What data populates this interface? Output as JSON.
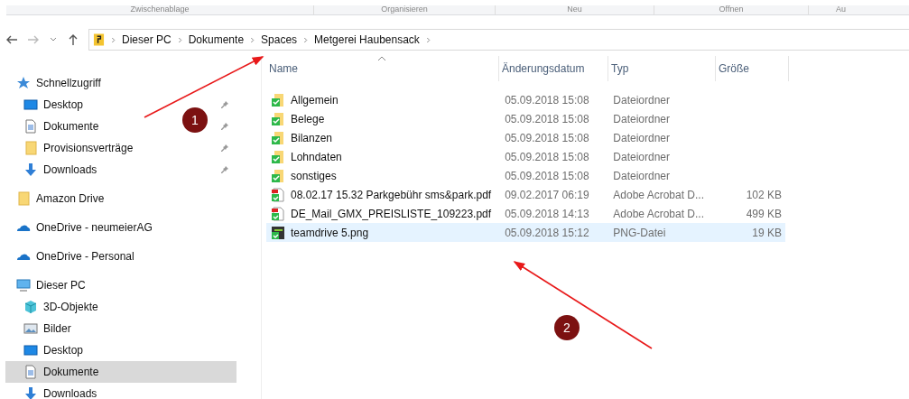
{
  "ribbon_groups": [
    "Zwischenablage",
    "Organisieren",
    "Neu",
    "Öffnen",
    "Au"
  ],
  "address_bar": {
    "path": [
      "Dieser PC",
      "Dokumente",
      "Spaces",
      "Metgerei Haubensack"
    ]
  },
  "sidebar": {
    "items": [
      {
        "label": "Schnellzugriff",
        "kind": "star",
        "selected": false,
        "children": [
          {
            "label": "Desktop",
            "kind": "desktop",
            "pinned": true,
            "selected": false
          },
          {
            "label": "Dokumente",
            "kind": "document",
            "pinned": true,
            "selected": false
          },
          {
            "label": "Provisionsverträge",
            "kind": "folder",
            "pinned": true,
            "selected": false
          },
          {
            "label": "Downloads",
            "kind": "download",
            "pinned": true,
            "selected": false
          }
        ]
      },
      {
        "label": "Amazon Drive",
        "kind": "folder",
        "selected": false
      },
      {
        "label": "OneDrive - neumeierAG",
        "kind": "cloud",
        "selected": false
      },
      {
        "label": "OneDrive - Personal",
        "kind": "cloud",
        "selected": false
      },
      {
        "label": "Dieser PC",
        "kind": "pc",
        "selected": false,
        "children": [
          {
            "label": "3D-Objekte",
            "kind": "cube",
            "pinned": false,
            "selected": false
          },
          {
            "label": "Bilder",
            "kind": "picture",
            "pinned": false,
            "selected": false
          },
          {
            "label": "Desktop",
            "kind": "desktop",
            "pinned": false,
            "selected": false
          },
          {
            "label": "Dokumente",
            "kind": "document",
            "pinned": false,
            "selected": true
          },
          {
            "label": "Downloads",
            "kind": "download",
            "pinned": false,
            "selected": false
          }
        ]
      }
    ]
  },
  "file_list": {
    "columns": [
      "Name",
      "Änderungsdatum",
      "Typ",
      "Größe"
    ],
    "rows": [
      {
        "name": "Allgemein",
        "date": "05.09.2018 15:08",
        "type": "Dateiordner",
        "kind": "folder",
        "selected": false
      },
      {
        "name": "Belege",
        "date": "05.09.2018 15:08",
        "type": "Dateiordner",
        "kind": "folder",
        "selected": false
      },
      {
        "name": "Bilanzen",
        "date": "05.09.2018 15:08",
        "type": "Dateiordner",
        "kind": "folder",
        "selected": false
      },
      {
        "name": "Lohndaten",
        "date": "05.09.2018 15:08",
        "type": "Dateiordner",
        "kind": "folder",
        "selected": false
      },
      {
        "name": "sonstiges",
        "date": "05.09.2018 15:08",
        "type": "Dateiordner",
        "kind": "folder",
        "selected": false
      },
      {
        "name": "08.02.17 15.32 Parkgebühr sms&park.pdf",
        "date": "09.02.2017 06:19",
        "type": "Adobe Acrobat D...",
        "size": "102 KB",
        "kind": "pdf",
        "selected": false
      },
      {
        "name": "DE_Mail_GMX_PREISLISTE_109223.pdf",
        "date": "05.09.2018 14:13",
        "type": "Adobe Acrobat D...",
        "size": "499 KB",
        "kind": "pdf",
        "selected": false
      },
      {
        "name": "teamdrive 5.png",
        "date": "05.09.2018 15:12",
        "type": "PNG-Datei",
        "size": "19 KB",
        "kind": "image",
        "selected": true
      }
    ]
  },
  "annotations": [
    {
      "number": "1"
    },
    {
      "number": "2"
    }
  ]
}
